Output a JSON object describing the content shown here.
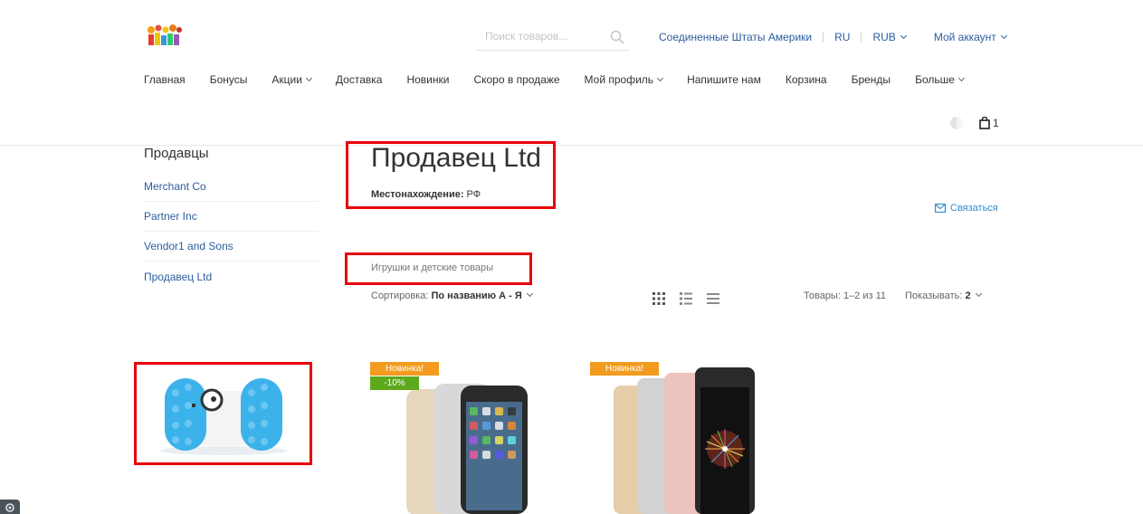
{
  "header": {
    "search_placeholder": "Поиск товаров...",
    "country": "Соединенные Штаты Америки",
    "language": "RU",
    "currency": "RUB",
    "account": "Мой аккаунт",
    "cart_count": "1"
  },
  "nav": {
    "items": [
      {
        "label": "Главная"
      },
      {
        "label": "Бонусы"
      },
      {
        "label": "Акции"
      },
      {
        "label": "Доставка"
      },
      {
        "label": "Новинки"
      },
      {
        "label": "Скоро в продаже"
      },
      {
        "label": "Мой профиль"
      },
      {
        "label": "Напишите нам"
      },
      {
        "label": "Корзина"
      },
      {
        "label": "Бренды"
      },
      {
        "label": "Больше"
      }
    ]
  },
  "sidebar": {
    "title": "Продавцы",
    "items": [
      {
        "label": "Merchant Co"
      },
      {
        "label": "Partner Inc"
      },
      {
        "label": "Vendor1 and Sons"
      },
      {
        "label": "Продавец Ltd"
      }
    ]
  },
  "vendor": {
    "name": "Продавец Ltd",
    "location_label": "Местонахождение:",
    "location_value": "РФ",
    "contact": "Связаться",
    "category": "Игрушки и детские товары"
  },
  "toolbar": {
    "sort_label": "Сортировка:",
    "sort_value": "По названию А - Я",
    "count": "Товары: 1–2 из 11",
    "perpage_label": "Показывать:",
    "perpage_value": "2"
  },
  "products": [
    {
      "badges": []
    },
    {
      "badges": [
        "Новинка!",
        "-10%"
      ]
    },
    {
      "badges": [
        "Новинка!"
      ]
    }
  ],
  "colors": {
    "link": "#2c5d9e",
    "contact": "#2c8bd1",
    "badge_new": "#f29b1f",
    "badge_sale": "#5da91c",
    "highlight": "#e8000b"
  }
}
